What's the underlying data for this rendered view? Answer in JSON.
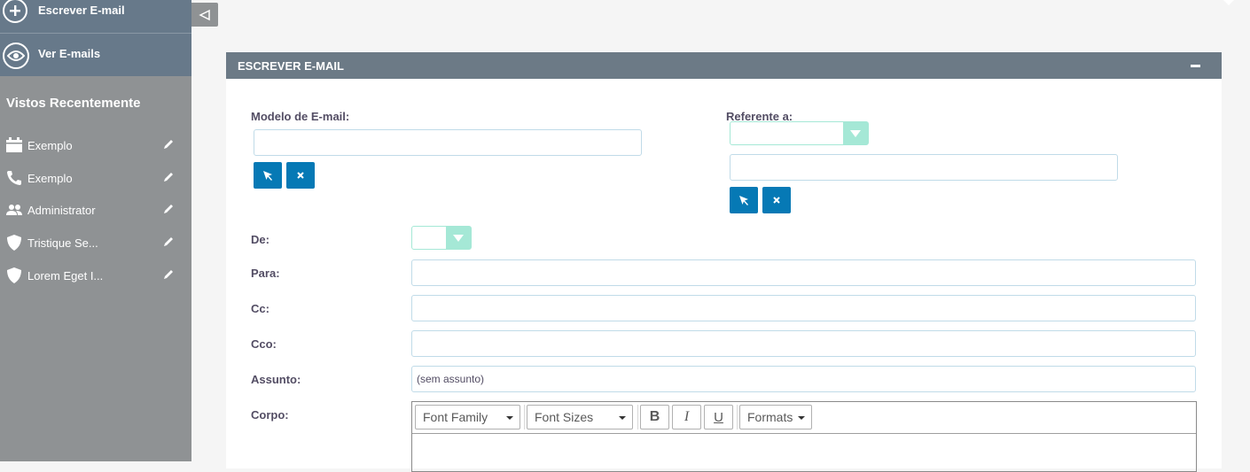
{
  "sidebar": {
    "actions": [
      {
        "label": "Escrever E-mail",
        "icon": "plus-icon"
      },
      {
        "label": "Ver E-mails",
        "icon": "eye-icon"
      }
    ],
    "recent_title": "Vistos Recentemente",
    "recent_items": [
      {
        "label": "Exemplo",
        "icon": "calendar-icon"
      },
      {
        "label": "Exemplo",
        "icon": "phone-icon"
      },
      {
        "label": "Administrator",
        "icon": "users-icon"
      },
      {
        "label": "Tristique Se...",
        "icon": "shield-icon"
      },
      {
        "label": "Lorem Eget I...",
        "icon": "shield-icon"
      }
    ]
  },
  "panel": {
    "title": "ESCREVER E-MAIL",
    "template_label": "Modelo de E-mail:",
    "related_label": "Referente a:",
    "from_label": "De:",
    "to_label": "Para:",
    "cc_label": "Cc:",
    "bcc_label": "Cco:",
    "subject_label": "Assunto:",
    "subject_value": "(sem assunto)",
    "body_label": "Corpo:"
  },
  "editor": {
    "font_family": "Font Family",
    "font_sizes": "Font Sizes",
    "bold": "B",
    "italic": "I",
    "underline": "U",
    "formats": "Formats"
  },
  "colors": {
    "sidebar": "#8f9294",
    "sidebar_actions": "#67798a",
    "panel_header": "#6c7a86",
    "button": "#0679b5",
    "input_border": "#a5e8d6"
  }
}
